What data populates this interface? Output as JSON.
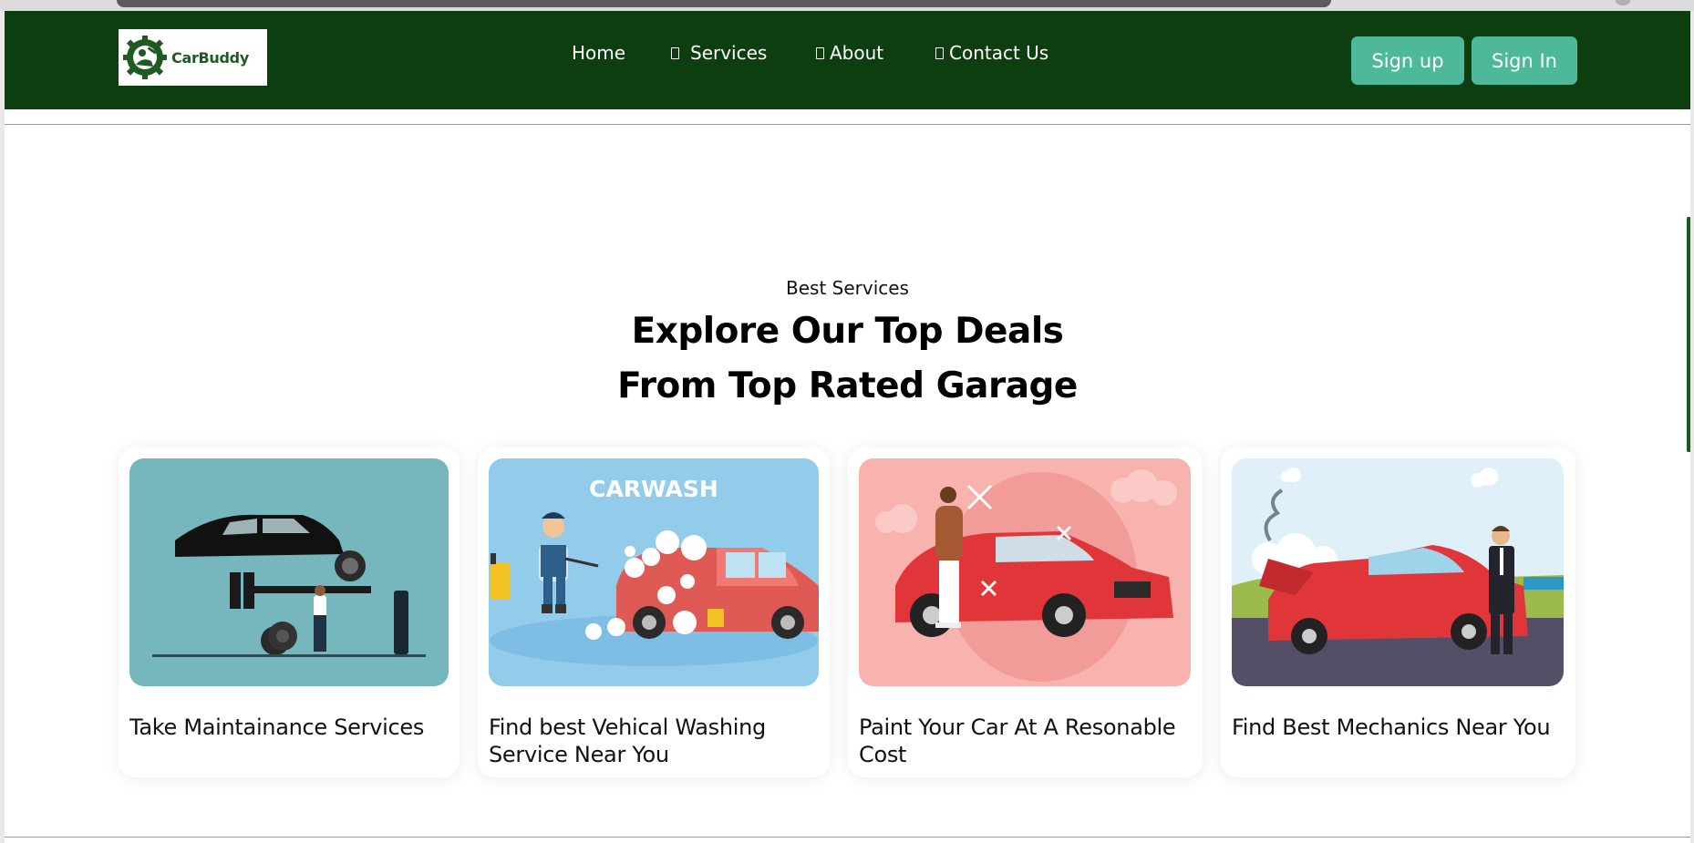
{
  "brand": {
    "name": "CarBuddy"
  },
  "nav": {
    "home": "Home",
    "services": "Services",
    "about": "About",
    "contact": "Contact Us"
  },
  "auth": {
    "signup": "Sign up",
    "signin": "Sign In"
  },
  "section": {
    "subtitle": "Best Services",
    "heading_line1": "Explore Our Top Deals",
    "heading_line2": "From Top Rated Garage"
  },
  "cards": [
    {
      "title": "Take Maintainance Services"
    },
    {
      "title": "Find best Vehical Washing Service Near You",
      "image_text": "CARWASH"
    },
    {
      "title": "Paint Your Car At A Resonable Cost"
    },
    {
      "title": "Find Best Mechanics Near You"
    }
  ],
  "colors": {
    "navbar": "#0c3e10",
    "button": "#4db89a",
    "card1_bg": "#76b6bd",
    "card2_bg": "#93cbea",
    "card3_bg": "#f8b3af",
    "card4_sky": "#dff0f9"
  }
}
